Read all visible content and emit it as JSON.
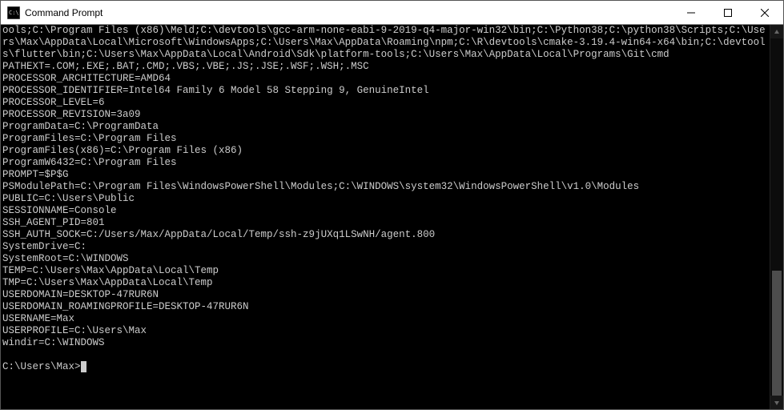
{
  "window": {
    "title": "Command Prompt"
  },
  "terminal": {
    "lines": [
      "ools;C:\\Program Files (x86)\\Meld;C:\\devtools\\gcc-arm-none-eabi-9-2019-q4-major-win32\\bin;C:\\Python38;C:\\python38\\Scripts;C:\\Users\\Max\\AppData\\Local\\Microsoft\\WindowsApps;C:\\Users\\Max\\AppData\\Roaming\\npm;C:\\R\\devtools\\cmake-3.19.4-win64-x64\\bin;C:\\devtools\\flutter\\bin;C:\\Users\\Max\\AppData\\Local\\Android\\Sdk\\platform-tools;C:\\Users\\Max\\AppData\\Local\\Programs\\Git\\cmd",
      "PATHEXT=.COM;.EXE;.BAT;.CMD;.VBS;.VBE;.JS;.JSE;.WSF;.WSH;.MSC",
      "PROCESSOR_ARCHITECTURE=AMD64",
      "PROCESSOR_IDENTIFIER=Intel64 Family 6 Model 58 Stepping 9, GenuineIntel",
      "PROCESSOR_LEVEL=6",
      "PROCESSOR_REVISION=3a09",
      "ProgramData=C:\\ProgramData",
      "ProgramFiles=C:\\Program Files",
      "ProgramFiles(x86)=C:\\Program Files (x86)",
      "ProgramW6432=C:\\Program Files",
      "PROMPT=$P$G",
      "PSModulePath=C:\\Program Files\\WindowsPowerShell\\Modules;C:\\WINDOWS\\system32\\WindowsPowerShell\\v1.0\\Modules",
      "PUBLIC=C:\\Users\\Public",
      "SESSIONNAME=Console",
      "SSH_AGENT_PID=801",
      "SSH_AUTH_SOCK=C:/Users/Max/AppData/Local/Temp/ssh-z9jUXq1LSwNH/agent.800",
      "SystemDrive=C:",
      "SystemRoot=C:\\WINDOWS",
      "TEMP=C:\\Users\\Max\\AppData\\Local\\Temp",
      "TMP=C:\\Users\\Max\\AppData\\Local\\Temp",
      "USERDOMAIN=DESKTOP-47RUR6N",
      "USERDOMAIN_ROAMINGPROFILE=DESKTOP-47RUR6N",
      "USERNAME=Max",
      "USERPROFILE=C:\\Users\\Max",
      "windir=C:\\WINDOWS",
      ""
    ],
    "prompt": "C:\\Users\\Max>"
  },
  "scrollbar": {
    "thumb_top_pct": 65,
    "thumb_height_pct": 35
  }
}
